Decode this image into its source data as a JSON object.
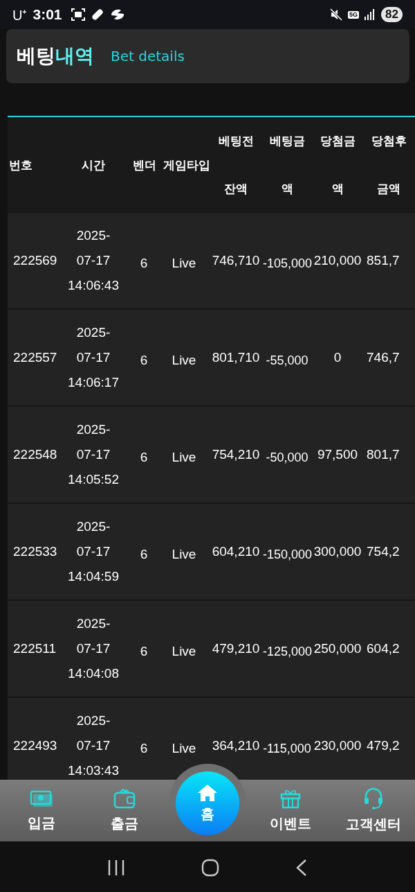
{
  "status_bar": {
    "carrier": "U⁺",
    "time": "3:01",
    "network": "5G",
    "battery": "82"
  },
  "header": {
    "title_white": "베팅",
    "title_cyan": "내역",
    "subtitle": "Bet details"
  },
  "table": {
    "columns": [
      "번호",
      "시간",
      "벤더",
      "게임타입",
      "베팅전 잔액",
      "베팅금 액",
      "당첨금 액",
      "당첨후 금액"
    ],
    "rows": [
      {
        "cells": [
          "222569",
          "2025-\n07-17\n14:06:43",
          "6",
          "Live",
          "746,710",
          "-105,000",
          "210,000",
          "851,7"
        ]
      },
      {
        "cells": [
          "222557",
          "2025-\n07-17\n14:06:17",
          "6",
          "Live",
          "801,710",
          "-55,000",
          "0",
          "746,7"
        ]
      },
      {
        "cells": [
          "222548",
          "2025-\n07-17\n14:05:52",
          "6",
          "Live",
          "754,210",
          "-50,000",
          "97,500",
          "801,7"
        ]
      },
      {
        "cells": [
          "222533",
          "2025-\n07-17\n14:04:59",
          "6",
          "Live",
          "604,210",
          "-150,000",
          "300,000",
          "754,2"
        ]
      },
      {
        "cells": [
          "222511",
          "2025-\n07-17\n14:04:08",
          "6",
          "Live",
          "479,210",
          "-125,000",
          "250,000",
          "604,2"
        ]
      },
      {
        "cells": [
          "222493",
          "2025-\n07-17\n14:03:43",
          "6",
          "Live",
          "364,210",
          "-115,000",
          "230,000",
          "479,2"
        ]
      }
    ]
  },
  "bottom_nav": [
    {
      "kind": "deposit",
      "label": "입금"
    },
    {
      "kind": "withdraw",
      "label": "출금"
    },
    {
      "kind": "home",
      "label": "홈"
    },
    {
      "kind": "event",
      "label": "이벤트"
    },
    {
      "kind": "support",
      "label": "고객센터"
    }
  ]
}
